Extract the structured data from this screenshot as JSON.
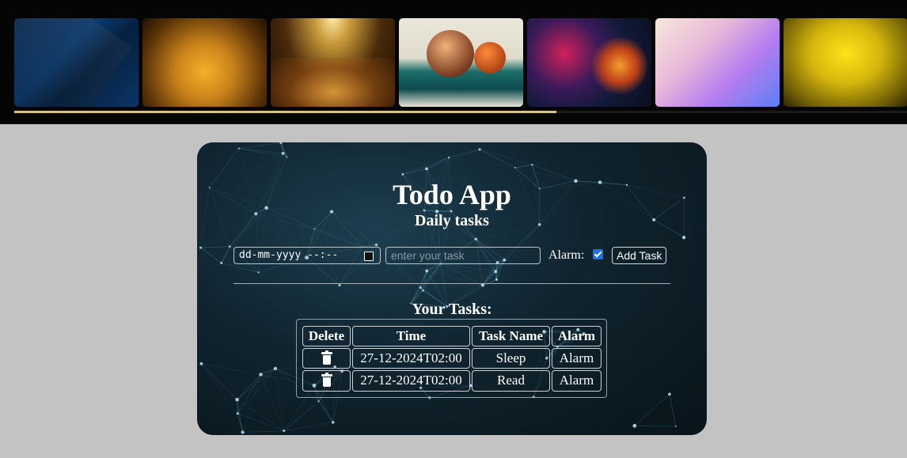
{
  "gallery": {
    "thumbnails": [
      {
        "icon": "abstract-blue-image"
      },
      {
        "icon": "golden-smoke-image"
      },
      {
        "icon": "golden-glitter-image"
      },
      {
        "icon": "abstract-spheres-image"
      },
      {
        "icon": "colorful-splash-image"
      },
      {
        "icon": "pastel-gradient-image"
      },
      {
        "icon": "yellow-glitter-image"
      }
    ],
    "scroll_progress": 0.607,
    "accent": "#d9c28a"
  },
  "app": {
    "title": "Todo App",
    "subtitle": "Daily tasks",
    "datetime_placeholder": "dd-mm-yyyy --:--",
    "task_placeholder": "enter your task",
    "alarm_label": "Alarm:",
    "alarm_checked": true,
    "add_button": "Add Task",
    "tasks_heading": "Your Tasks:",
    "table": {
      "headers": [
        "Delete",
        "Time",
        "Task Name",
        "Alarm"
      ],
      "rows": [
        {
          "delete_icon": "trash-icon",
          "time": "27-12-2024T02:00",
          "name": "Sleep",
          "alarm": "Alarm"
        },
        {
          "delete_icon": "trash-icon",
          "time": "27-12-2024T02:00",
          "name": "Read",
          "alarm": "Alarm"
        }
      ]
    }
  }
}
